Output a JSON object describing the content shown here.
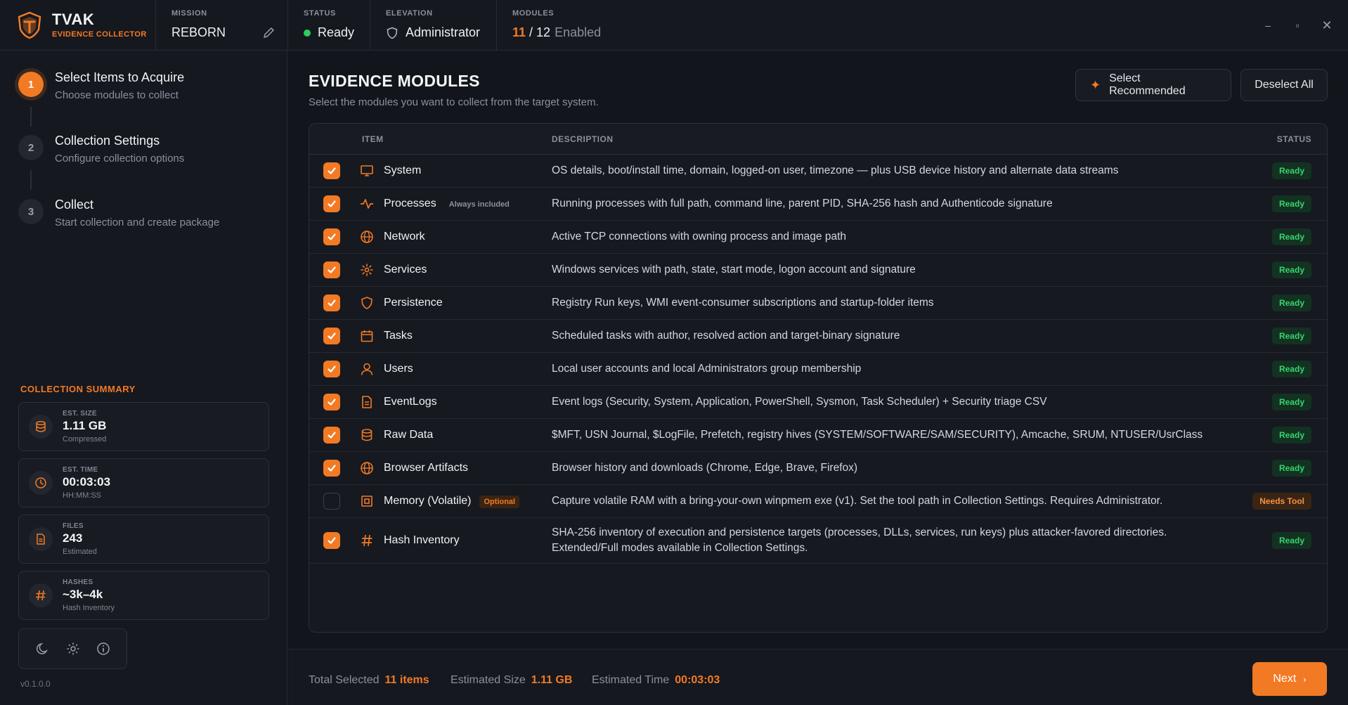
{
  "brand": {
    "name": "TVAK",
    "subtitle": "EVIDENCE COLLECTOR"
  },
  "topbar": {
    "mission_label": "MISSION",
    "mission_value": "REBORN",
    "status_label": "STATUS",
    "status_value": "Ready",
    "elevation_label": "ELEVATION",
    "elevation_value": "Administrator",
    "modules_label": "MODULES",
    "modules_selected": "11",
    "modules_total": "/ 12",
    "modules_word": "Enabled"
  },
  "window": {
    "minimize": "–",
    "maximize": "▫",
    "close": "✕"
  },
  "steps": [
    {
      "num": "1",
      "title": "Select Items to Acquire",
      "sub": "Choose modules to collect"
    },
    {
      "num": "2",
      "title": "Collection Settings",
      "sub": "Configure collection options"
    },
    {
      "num": "3",
      "title": "Collect",
      "sub": "Start collection and create package"
    }
  ],
  "summary": {
    "title": "COLLECTION SUMMARY",
    "cards": [
      {
        "label": "EST. SIZE",
        "value": "1.11 GB",
        "sub": "Compressed",
        "icon": "database-icon"
      },
      {
        "label": "EST. TIME",
        "value": "00:03:03",
        "sub": "HH:MM:SS",
        "icon": "clock-icon"
      },
      {
        "label": "FILES",
        "value": "243",
        "sub": "Estimated",
        "icon": "file-icon"
      },
      {
        "label": "HASHES",
        "value": "~3k–4k",
        "sub": "Hash Inventory",
        "icon": "hash-icon"
      }
    ]
  },
  "version": "v0.1.0.0",
  "main": {
    "title": "EVIDENCE MODULES",
    "subtitle": "Select the modules you want to collect from the target system.",
    "select_recommended": "Select Recommended",
    "deselect_all": "Deselect All"
  },
  "table": {
    "headers": {
      "item": "ITEM",
      "description": "DESCRIPTION",
      "status": "STATUS"
    },
    "rows": [
      {
        "name": "System",
        "checked": true,
        "desc": "OS details, boot/install time, domain, logged-on user, timezone — plus USB device history and alternate data streams",
        "status": "Ready",
        "icon": "monitor-icon"
      },
      {
        "name": "Processes",
        "badge": "Always included",
        "checked": true,
        "desc": "Running processes with full path, command line, parent PID, SHA-256 hash and Authenticode signature",
        "status": "Ready",
        "icon": "activity-icon"
      },
      {
        "name": "Network",
        "checked": true,
        "desc": "Active TCP connections with owning process and image path",
        "status": "Ready",
        "icon": "globe-icon"
      },
      {
        "name": "Services",
        "checked": true,
        "desc": "Windows services with path, state, start mode, logon account and signature",
        "status": "Ready",
        "icon": "gear-icon"
      },
      {
        "name": "Persistence",
        "checked": true,
        "desc": "Registry Run keys, WMI event-consumer subscriptions and startup-folder items",
        "status": "Ready",
        "icon": "shield-icon"
      },
      {
        "name": "Tasks",
        "checked": true,
        "desc": "Scheduled tasks with author, resolved action and target-binary signature",
        "status": "Ready",
        "icon": "calendar-icon"
      },
      {
        "name": "Users",
        "checked": true,
        "desc": "Local user accounts and local Administrators group membership",
        "status": "Ready",
        "icon": "user-icon"
      },
      {
        "name": "EventLogs",
        "checked": true,
        "desc": "Event logs (Security, System, Application, PowerShell, Sysmon, Task Scheduler) + Security triage CSV",
        "status": "Ready",
        "icon": "document-icon"
      },
      {
        "name": "Raw Data",
        "checked": true,
        "desc": "$MFT, USN Journal, $LogFile, Prefetch, registry hives (SYSTEM/SOFTWARE/SAM/SECURITY), Amcache, SRUM, NTUSER/UsrClass",
        "status": "Ready",
        "icon": "database-icon"
      },
      {
        "name": "Browser Artifacts",
        "checked": true,
        "desc": "Browser history and downloads (Chrome, Edge, Brave, Firefox)",
        "status": "Ready",
        "icon": "globe-icon"
      },
      {
        "name": "Memory (Volatile)",
        "badge": "Optional",
        "checked": false,
        "desc": "Capture volatile RAM with a bring-your-own winpmem exe (v1). Set the tool path in Collection Settings. Requires Administrator.",
        "status": "Needs Tool",
        "icon": "chip-icon"
      },
      {
        "name": "Hash Inventory",
        "checked": true,
        "desc": "SHA-256 inventory of execution and persistence targets (processes, DLLs, services, run keys) plus attacker-favored directories. Extended/Full modes available in Collection Settings.",
        "status": "Ready",
        "icon": "hash-icon"
      }
    ]
  },
  "footer": {
    "total_label": "Total Selected",
    "total_value": "11 items",
    "size_label": "Estimated Size",
    "size_value": "1.11 GB",
    "time_label": "Estimated Time",
    "time_value": "00:03:03",
    "next": "Next"
  },
  "colors": {
    "accent": "#f27a24",
    "ready": "#36d36d",
    "background": "#12151b"
  }
}
